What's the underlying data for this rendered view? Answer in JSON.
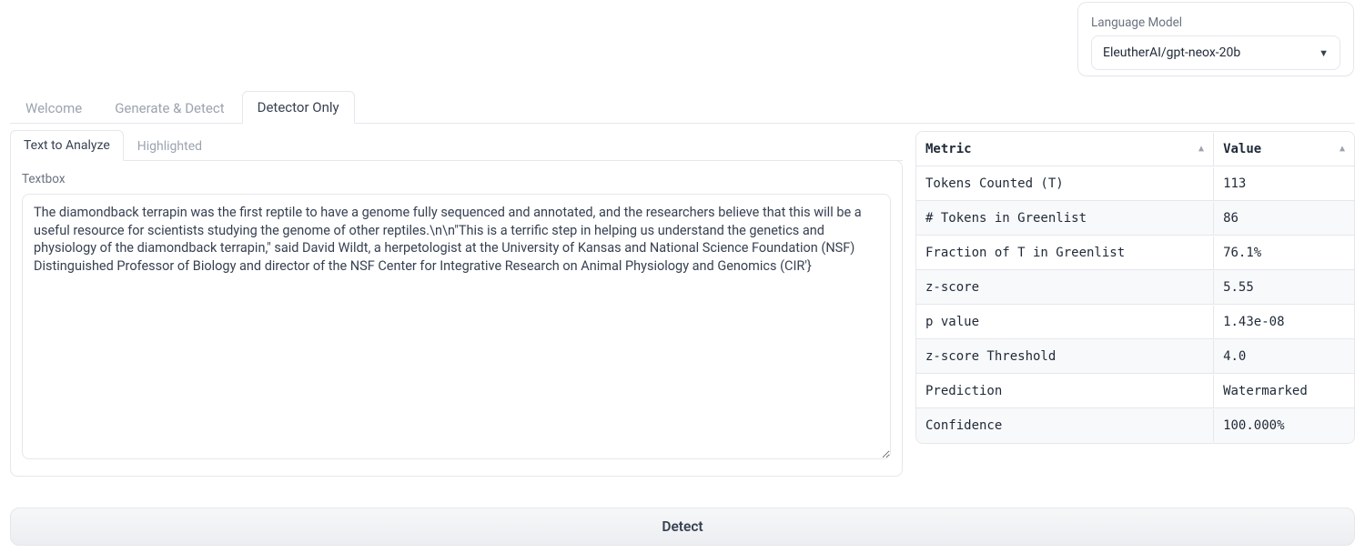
{
  "language_model": {
    "label": "Language Model",
    "selected": "EleutherAI/gpt-neox-20b"
  },
  "main_tabs": [
    {
      "label": "Welcome"
    },
    {
      "label": "Generate & Detect"
    },
    {
      "label": "Detector Only"
    }
  ],
  "sub_tabs": [
    {
      "label": "Text to Analyze"
    },
    {
      "label": "Highlighted"
    }
  ],
  "textbox": {
    "label": "Textbox",
    "value": "The diamondback terrapin was the first reptile to have a genome fully sequenced and annotated, and the researchers believe that this will be a useful resource for scientists studying the genome of other reptiles.\\n\\n\"This is a terrific step in helping us understand the genetics and physiology of the diamondback terrapin,\" said David Wildt, a herpetologist at the University of Kansas and National Science Foundation (NSF) Distinguished Professor of Biology and director of the NSF Center for Integrative Research on Animal Physiology and Genomics (CIR'}"
  },
  "metrics_table": {
    "headers": {
      "metric": "Metric",
      "value": "Value"
    },
    "rows": [
      {
        "metric": "Tokens Counted (T)",
        "value": "113"
      },
      {
        "metric": "# Tokens in Greenlist",
        "value": "86"
      },
      {
        "metric": "Fraction of T in Greenlist",
        "value": "76.1%"
      },
      {
        "metric": "z-score",
        "value": "5.55"
      },
      {
        "metric": "p value",
        "value": "1.43e-08"
      },
      {
        "metric": "z-score Threshold",
        "value": "4.0"
      },
      {
        "metric": "Prediction",
        "value": "Watermarked"
      },
      {
        "metric": "Confidence",
        "value": "100.000%"
      }
    ]
  },
  "detect_button": {
    "label": "Detect"
  }
}
